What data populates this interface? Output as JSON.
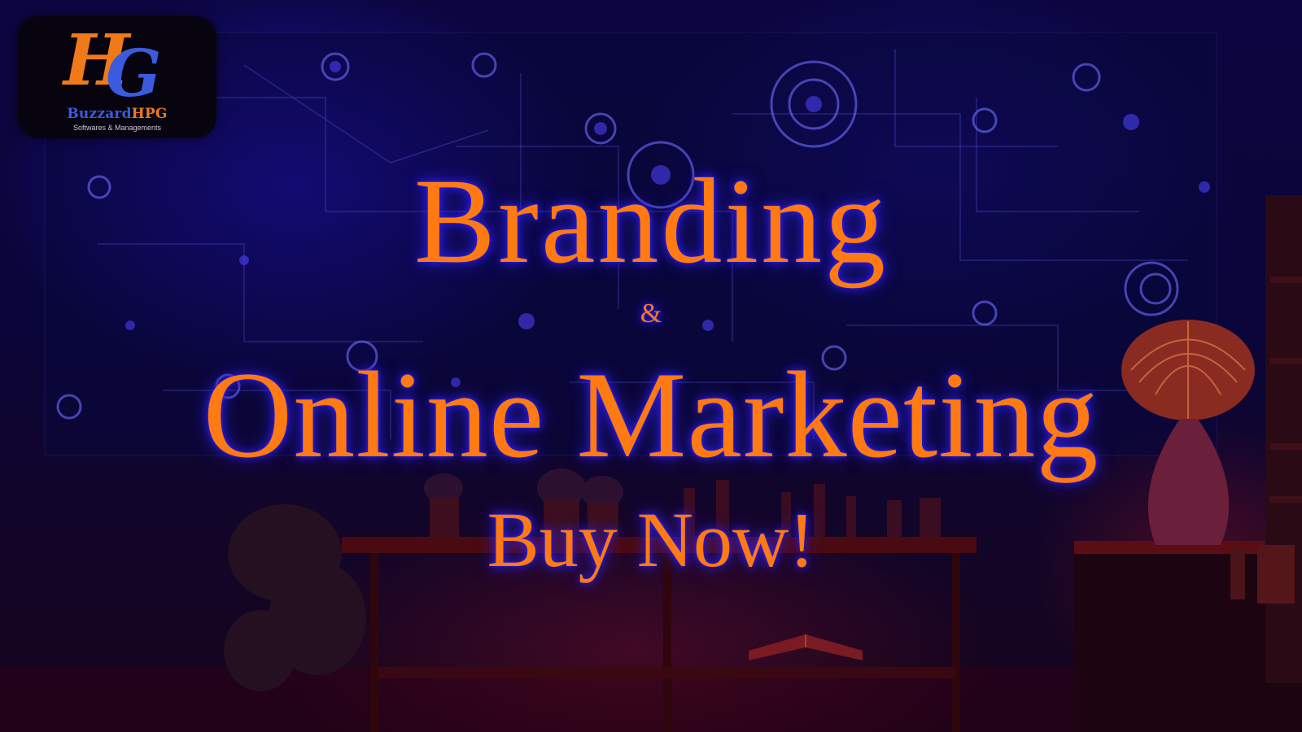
{
  "logo": {
    "monogram_left": "H",
    "monogram_right": "G",
    "brand_prefix": "Buzzard",
    "brand_suffix": "HPG",
    "tagline": "Softwares & Managements"
  },
  "headline": {
    "line1": "Branding",
    "ampersand": "&",
    "line2": "Online Marketing",
    "cta": "Buy Now!"
  },
  "colors": {
    "headline_text": "#ff7a12",
    "headline_glow": "#3c28ff",
    "logo_orange": "#f07a1a",
    "logo_blue": "#3b5bdf",
    "background_blue": "#0b0640",
    "background_red": "#7a0f28"
  },
  "icons": [
    "circuit-network-icon",
    "plant-icon",
    "vase-icon",
    "book-icon",
    "shelf-icon"
  ]
}
